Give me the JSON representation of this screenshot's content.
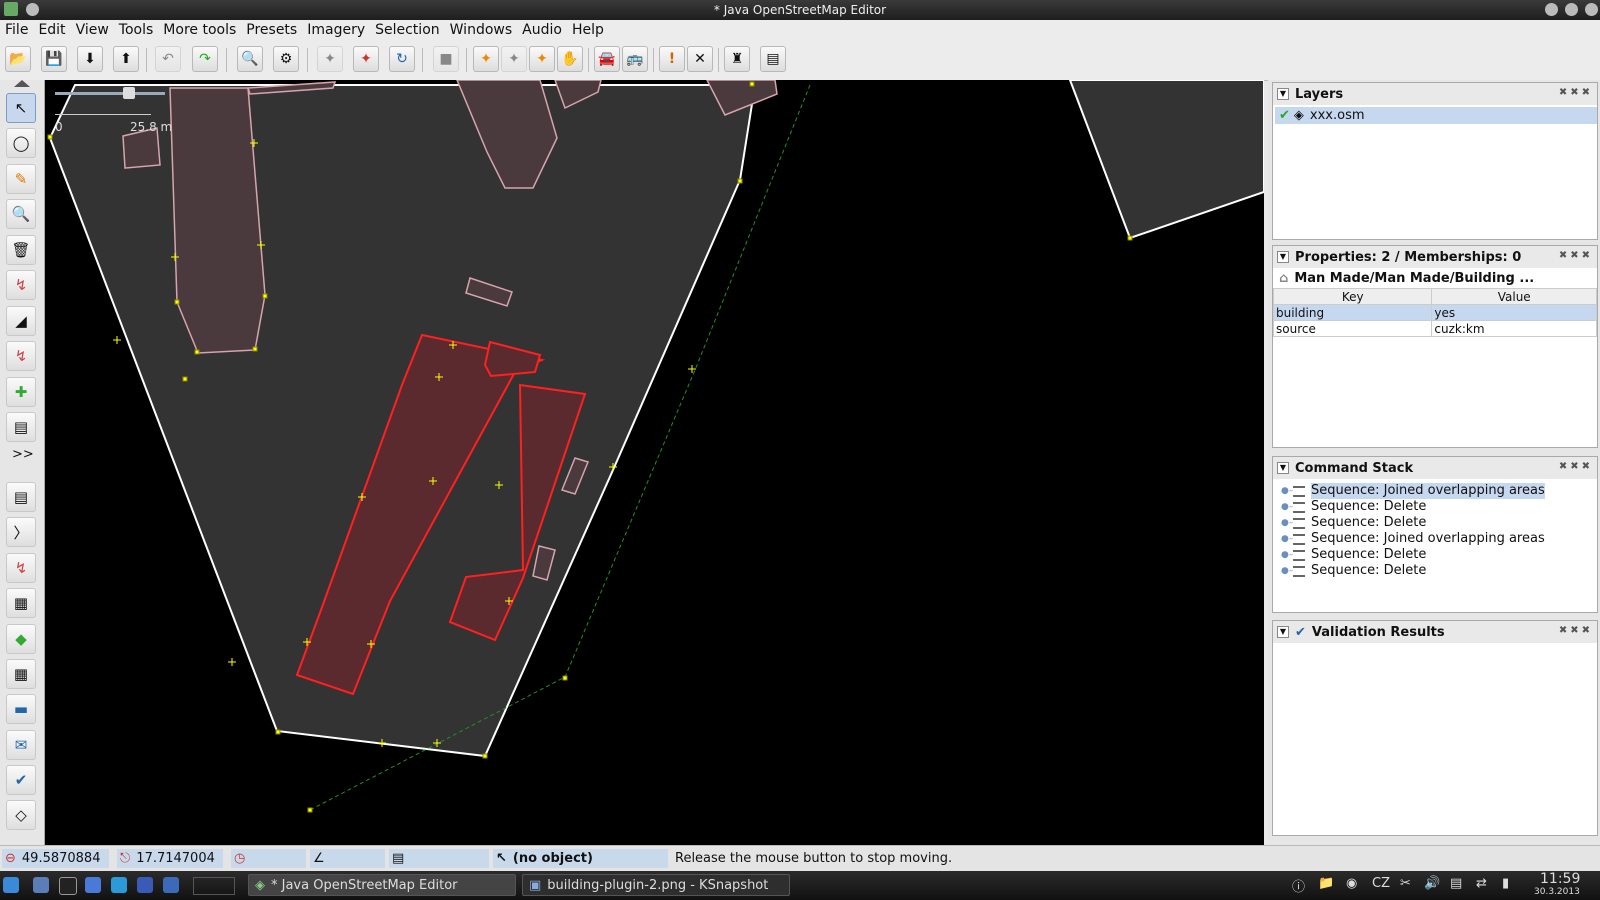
{
  "window": {
    "title": "* Java OpenStreetMap Editor"
  },
  "menu": [
    "File",
    "Edit",
    "View",
    "Tools",
    "More tools",
    "Presets",
    "Imagery",
    "Selection",
    "Windows",
    "Audio",
    "Help"
  ],
  "map": {
    "scale_start": "0",
    "scale_end": "25.8 m"
  },
  "layers": {
    "title": "Layers",
    "items": [
      {
        "name": "xxx.osm"
      }
    ]
  },
  "properties": {
    "title": "Properties: 2 / Memberships: 0",
    "preset": "Man Made/Man Made/Building ...",
    "columns": {
      "key": "Key",
      "value": "Value"
    },
    "rows": [
      {
        "key": "building",
        "value": "yes"
      },
      {
        "key": "source",
        "value": "cuzk:km"
      }
    ]
  },
  "command_stack": {
    "title": "Command Stack",
    "items": [
      "Sequence: Joined overlapping areas",
      "Sequence: Delete",
      "Sequence: Delete",
      "Sequence: Joined overlapping areas",
      "Sequence: Delete",
      "Sequence: Delete"
    ]
  },
  "validation": {
    "title": "Validation Results"
  },
  "status": {
    "lat": "49.5870884",
    "lon": "17.7147004",
    "object": "(no object)",
    "message": "Release the mouse button to stop moving."
  },
  "taskbar": {
    "tasks": [
      "* Java OpenStreetMap Editor",
      "building-plugin-2.png - KSnapshot"
    ],
    "keyboard": "CZ",
    "time": "11:59",
    "date": "30.3.2013"
  },
  "colors": {
    "selection": "#ff2020",
    "building_fill": "#4a3a3e",
    "area_fill": "#333333",
    "highlight": "#c6d8ef"
  }
}
